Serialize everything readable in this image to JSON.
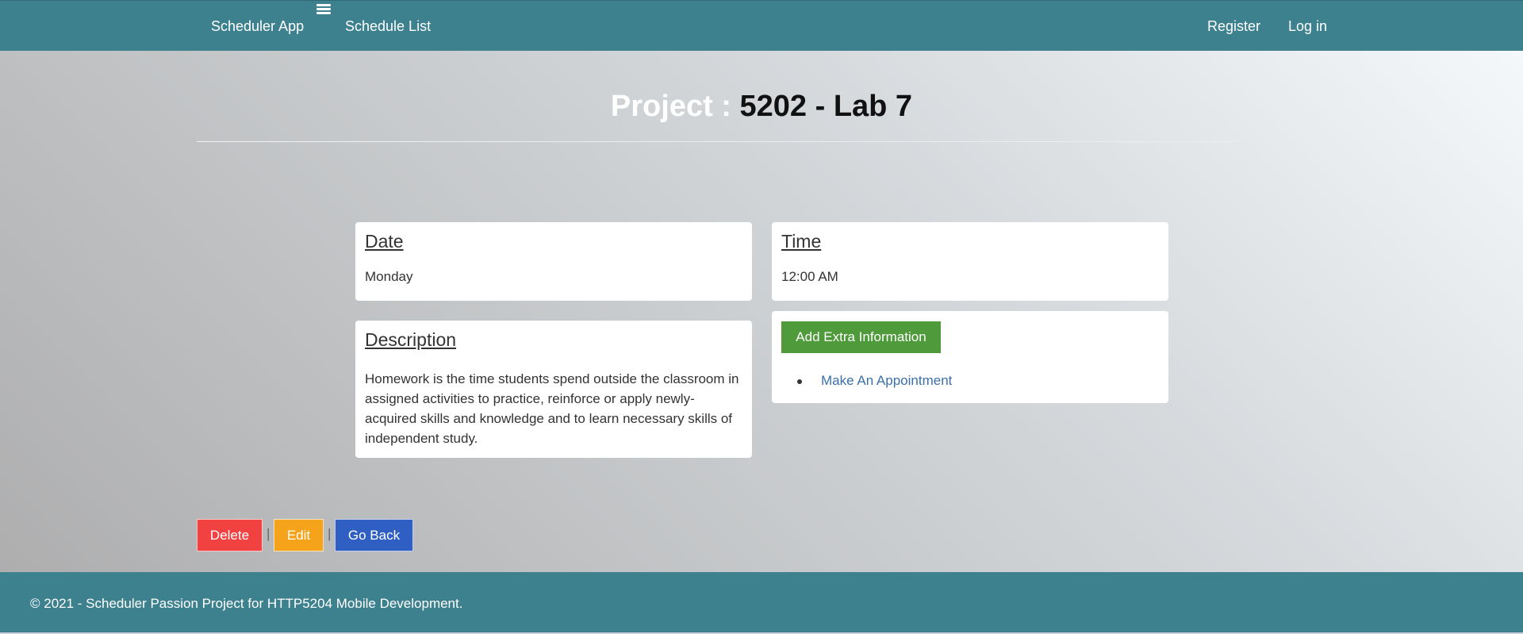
{
  "nav": {
    "brand": "Scheduler App",
    "schedule_list": "Schedule List",
    "register": "Register",
    "login": "Log in",
    "toggle_icon": "menu-icon"
  },
  "page": {
    "title_label": "Project :",
    "title_value": "5202 - Lab 7"
  },
  "date_card": {
    "heading": "Date",
    "value": "Monday"
  },
  "time_card": {
    "heading": "Time",
    "value": "12:00 AM"
  },
  "description_card": {
    "heading": "Description",
    "text": "Homework is the time students spend outside the classroom in assigned activities to practice, reinforce or apply newly-acquired skills and knowledge and to learn necessary skills of independent study."
  },
  "extra_card": {
    "add_button": "Add Extra Information",
    "appointment_link": "Make An Appointment"
  },
  "actions": {
    "delete": "Delete",
    "edit": "Edit",
    "go_back": "Go Back",
    "separator": "|"
  },
  "footer": {
    "text": "© 2021 - Scheduler Passion Project for HTTP5204 Mobile Development."
  },
  "colors": {
    "nav_bg": "#3d808e",
    "delete": "#f24141",
    "edit": "#f5a31a",
    "go_back": "#2f5fc2",
    "add_button": "#4f9a3a",
    "link": "#3a6fa8"
  }
}
